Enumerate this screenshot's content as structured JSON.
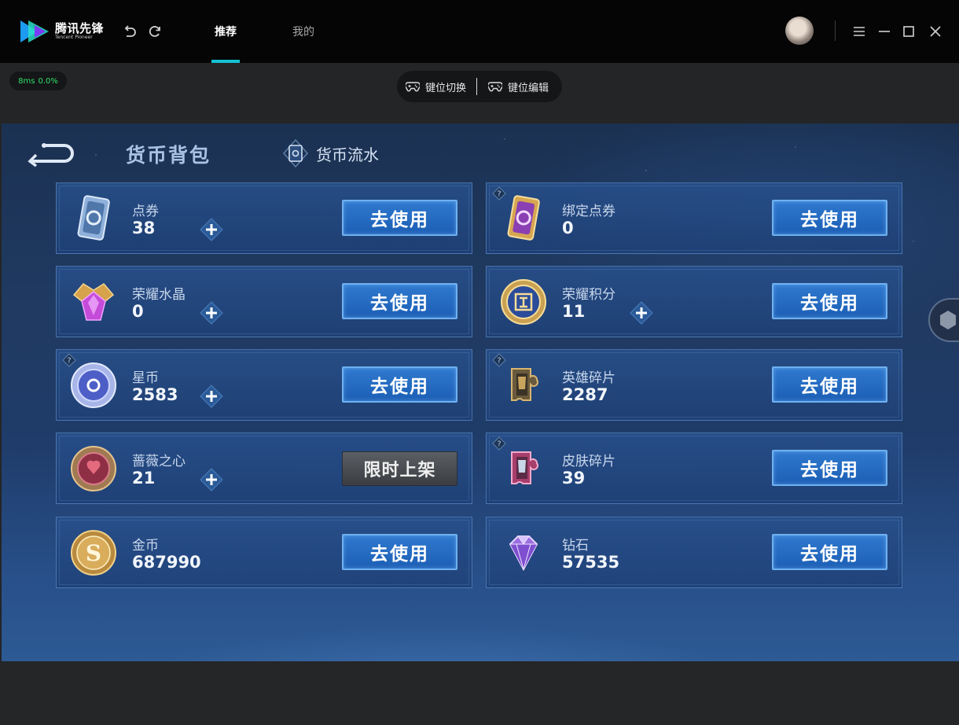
{
  "app": {
    "logo_cn": "腾讯先锋",
    "logo_en": "Tencent Pioneer",
    "tabs": [
      {
        "label": "推荐",
        "active": true
      },
      {
        "label": "我的",
        "active": false
      }
    ],
    "icons": {
      "undo": "undo-icon",
      "refresh": "refresh-icon",
      "menu": "menu-icon",
      "minimize": "minimize-icon",
      "maximize": "maximize-icon",
      "close": "close-icon"
    }
  },
  "status": {
    "latency": "8ms",
    "loss": "0.0%"
  },
  "keybar": {
    "switch_label": "键位切换",
    "edit_label": "键位编辑"
  },
  "game": {
    "title": "货币背包",
    "ledger_label": "货币流水",
    "use_label": "去使用",
    "limited_label": "限时上架",
    "cards_left": [
      {
        "name": "点券",
        "amount": "38",
        "plus": true,
        "help": false,
        "button": "use",
        "icon": "coupon-icon"
      },
      {
        "name": "荣耀水晶",
        "amount": "0",
        "plus": true,
        "help": false,
        "button": "use",
        "icon": "glory-crystal-icon"
      },
      {
        "name": "星币",
        "amount": "2583",
        "plus": true,
        "help": true,
        "button": "use",
        "icon": "star-coin-icon"
      },
      {
        "name": "蔷薇之心",
        "amount": "21",
        "plus": true,
        "help": false,
        "button": "limited",
        "icon": "rose-heart-icon"
      },
      {
        "name": "金币",
        "amount": "687990",
        "plus": false,
        "help": false,
        "button": "use",
        "icon": "gold-coin-icon"
      }
    ],
    "cards_right": [
      {
        "name": "绑定点券",
        "amount": "0",
        "plus": false,
        "help": true,
        "button": "use",
        "icon": "bound-coupon-icon"
      },
      {
        "name": "荣耀积分",
        "amount": "11",
        "plus": true,
        "help": false,
        "button": "use",
        "icon": "glory-points-icon"
      },
      {
        "name": "英雄碎片",
        "amount": "2287",
        "plus": false,
        "help": true,
        "button": "use",
        "icon": "hero-shard-icon"
      },
      {
        "name": "皮肤碎片",
        "amount": "39",
        "plus": false,
        "help": true,
        "button": "use",
        "icon": "skin-shard-icon"
      },
      {
        "name": "钻石",
        "amount": "57535",
        "plus": false,
        "help": false,
        "button": "use",
        "icon": "diamond-icon"
      }
    ]
  }
}
